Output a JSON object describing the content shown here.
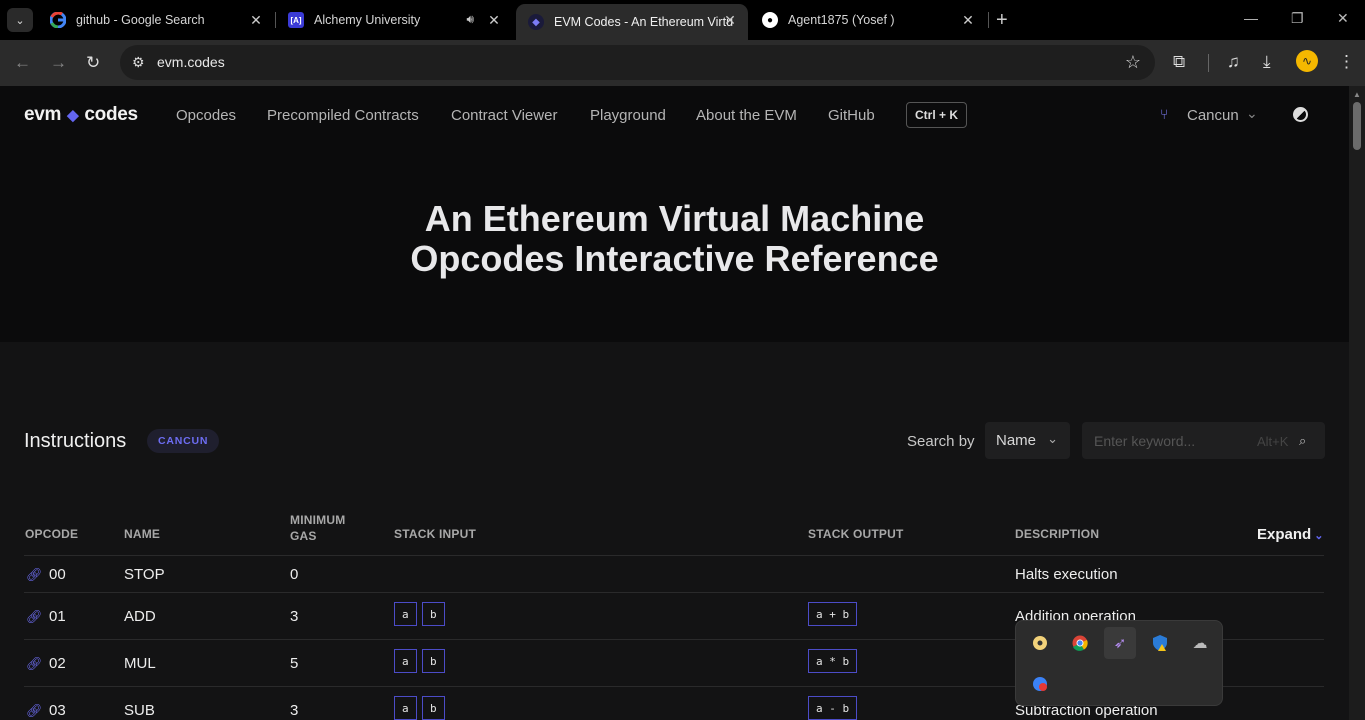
{
  "browser": {
    "tabs": [
      {
        "title": "github - Google Search",
        "favicon": "google-icon"
      },
      {
        "title": "Alchemy University",
        "favicon": "alchemy-icon"
      },
      {
        "title": "EVM Codes - An Ethereum Virtu",
        "favicon": "evm-icon"
      },
      {
        "title": "Agent1875 (Yosef )",
        "favicon": "github-icon"
      }
    ],
    "url": "evm.codes"
  },
  "site": {
    "logo_left": "evm",
    "logo_right": "codes",
    "nav": [
      "Opcodes",
      "Precompiled Contracts",
      "Contract Viewer",
      "Playground",
      "About the EVM",
      "GitHub"
    ],
    "shortcut": "Ctrl + K",
    "network": "Cancun",
    "hero": {
      "line1": "An Ethereum Virtual Machine",
      "line2": "Opcodes Interactive Reference"
    },
    "instructions": {
      "title": "Instructions",
      "badge": "CANCUN",
      "search_label": "Search by",
      "search_by": "Name",
      "search_placeholder": "Enter keyword...",
      "search_hint": "Alt+K",
      "expand": "Expand"
    },
    "table": {
      "headers": {
        "opcode": "OPCODE",
        "name": "NAME",
        "gas1": "MINIMUM",
        "gas2": "GAS",
        "input": "STACK INPUT",
        "output": "STACK OUTPUT",
        "description": "DESCRIPTION"
      },
      "rows": [
        {
          "opcode": "00",
          "name": "STOP",
          "gas": "0",
          "input": [],
          "output": "",
          "description": "Halts execution"
        },
        {
          "opcode": "01",
          "name": "ADD",
          "gas": "3",
          "input": [
            "a",
            "b"
          ],
          "output": "a + b",
          "description": "Addition operation"
        },
        {
          "opcode": "02",
          "name": "MUL",
          "gas": "5",
          "input": [
            "a",
            "b"
          ],
          "output": "a * b",
          "description": ""
        },
        {
          "opcode": "03",
          "name": "SUB",
          "gas": "3",
          "input": [
            "a",
            "b"
          ],
          "output": "a - b",
          "description": "Subtraction operation"
        }
      ]
    }
  }
}
